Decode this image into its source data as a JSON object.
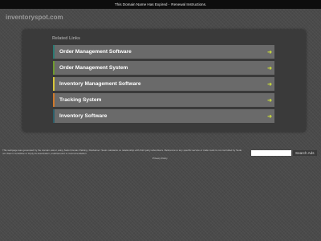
{
  "topbar": {
    "message": "This Domain Name Has Expired - ",
    "link_text": "Renewal Instructions."
  },
  "site": {
    "domain": "inventoryspot.com"
  },
  "related": {
    "title": "Related Links",
    "links": [
      {
        "label": "Order Management Software",
        "color": "#2b7a73",
        "arrow": "➜"
      },
      {
        "label": "Order Management System",
        "color": "#6f9a2e",
        "arrow": "➜"
      },
      {
        "label": "Inventory Management Software",
        "color": "#d7c63a",
        "arrow": "➜"
      },
      {
        "label": "Tracking System",
        "color": "#d0782a",
        "arrow": "➜"
      },
      {
        "label": "Inventory Software",
        "color": "#2a5f6a",
        "arrow": "➜"
      }
    ],
    "arrow_color": "#c7d93a"
  },
  "footer": {
    "disclaimer": "This webpage was generated by the domain owner using Sedo Domain Parking. Disclaimer: Sedo maintains no relationship with third party advertisers. Reference to any specific service or trade mark is not controlled by Sedo nor does it constitute or imply its association, endorsement or recommendation.",
    "search_placeholder": "",
    "search_button": "Search Ads",
    "privacy": "Privacy Policy"
  }
}
